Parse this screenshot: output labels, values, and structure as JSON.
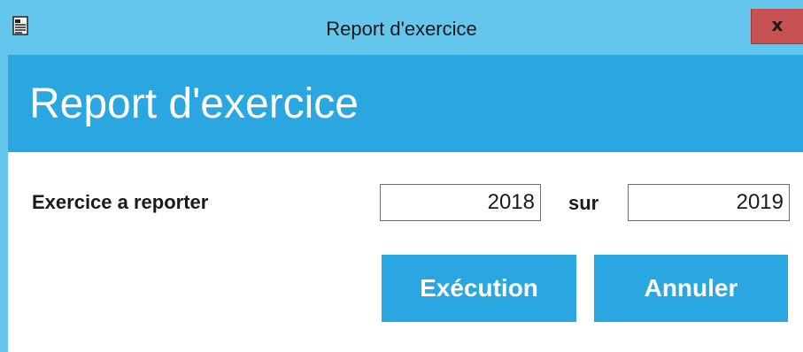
{
  "window": {
    "title": "Report d'exercice",
    "icon": "document-icon",
    "close_label": "x"
  },
  "header": {
    "title": "Report d'exercice"
  },
  "form": {
    "label": "Exercice a reporter",
    "from_year": "2018",
    "separator_label": "sur",
    "to_year": "2019"
  },
  "actions": {
    "execute_label": "Exécution",
    "cancel_label": "Annuler"
  },
  "colors": {
    "titlebar": "#64c6ec",
    "header_band": "#2aa7e0",
    "buttons": "#2aa7e0",
    "close_button": "#c75050"
  }
}
